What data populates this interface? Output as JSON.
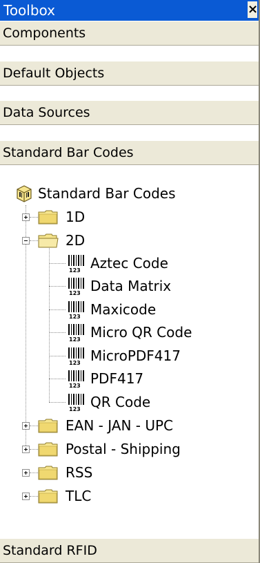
{
  "window": {
    "title": "Toolbox",
    "close_glyph": "×"
  },
  "categories": {
    "components": "Components",
    "default_objects": "Default Objects",
    "data_sources": "Data Sources",
    "standard_bar_codes": "Standard Bar Codes",
    "standard_rfid": "Standard RFID"
  },
  "tree": {
    "root_label": "Standard Bar Codes",
    "folders": {
      "f1d": "1D",
      "f2d": "2D",
      "ean": "EAN - JAN - UPC",
      "postal": "Postal - Shipping",
      "rss": "RSS",
      "tlc": "TLC"
    },
    "items_2d": [
      "Aztec Code",
      "Data Matrix",
      "Maxicode",
      "Micro QR Code",
      "MicroPDF417",
      "PDF417",
      "QR Code"
    ]
  },
  "icons": {
    "root": "barcode-collection-icon",
    "folder_closed": "folder-closed-icon",
    "folder_open": "folder-open-icon",
    "barcode": "barcode-icon",
    "expand": "expand-plus-icon",
    "collapse": "collapse-minus-icon"
  },
  "colors": {
    "titlebar": "#0a5ad4",
    "category_bg": "#ece9d8",
    "folder": "#f0d870"
  }
}
